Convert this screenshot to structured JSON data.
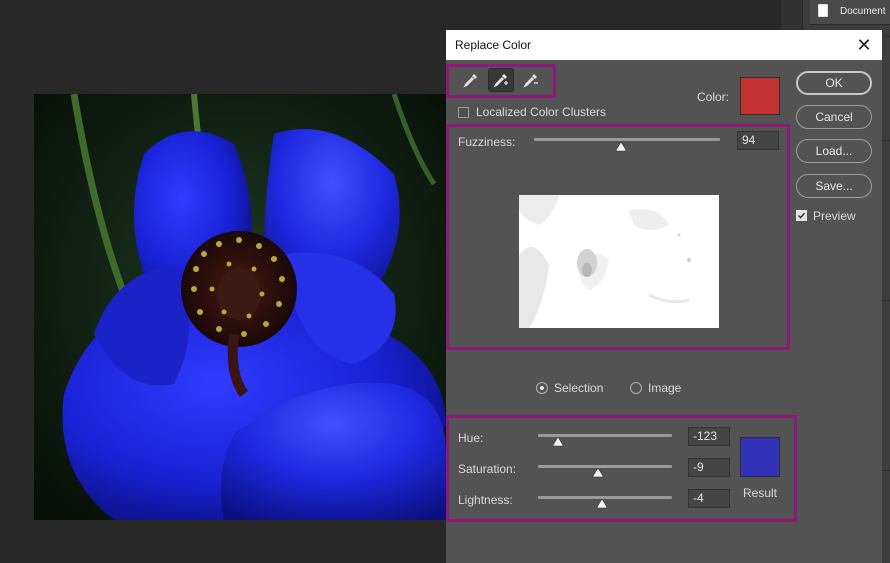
{
  "dialog": {
    "title": "Replace Color",
    "close_label": "✕",
    "localized_clusters_label": "Localized Color Clusters",
    "localized_clusters_checked": false,
    "color_label": "Color:",
    "color_swatch": "#c43232",
    "fuzziness_label": "Fuzziness:",
    "fuzziness_value": "94",
    "fuzziness_fraction": 0.47,
    "view_selection_label": "Selection",
    "view_image_label": "Image",
    "view_selected": "selection",
    "hue_label": "Hue:",
    "hue_value": "-123",
    "hue_fraction": 0.15,
    "saturation_label": "Saturation:",
    "saturation_value": "-9",
    "saturation_fraction": 0.45,
    "lightness_label": "Lightness:",
    "lightness_value": "-4",
    "lightness_fraction": 0.48,
    "result_label": "Result",
    "result_swatch": "#3232b8"
  },
  "buttons": {
    "ok": "OK",
    "cancel": "Cancel",
    "load": "Load...",
    "save": "Save...",
    "preview_label": "Preview",
    "preview_checked": true
  },
  "document_tab": {
    "label": "Document"
  },
  "icons": [
    "eyedropper-icon",
    "eyedropper-plus-icon",
    "eyedropper-minus-icon",
    "document-icon",
    "close-icon",
    "checkmark-icon"
  ],
  "colors": {
    "highlight": "#8e1a78",
    "dialog_bg": "#535353"
  }
}
